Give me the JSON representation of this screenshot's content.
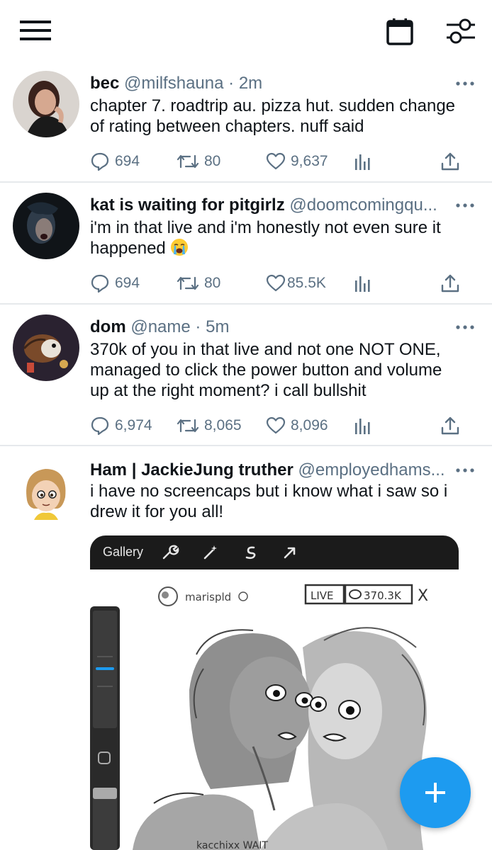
{
  "topbar": {
    "menu_icon": "hamburger-menu-icon",
    "calendar_icon": "calendar-icon",
    "filter_icon": "sliders-icon"
  },
  "tweets": [
    {
      "name": "bec",
      "handle": "@milfshauna",
      "sep": "·",
      "time": "2m",
      "text_lines": [
        "chapter 7. roadtrip au. pizza hut. sudden change",
        "of rating between chapters. nuff said"
      ],
      "replies": "694",
      "retweets": "80",
      "likes": "9,637"
    },
    {
      "name": "kat is waiting for pitgirlz",
      "handle": "@doomcomingqu...",
      "text_lines": [
        "i'm in that live and i'm honestly not even sure it",
        "happened"
      ],
      "emoji": "loudly-crying-face-emoji",
      "replies": "694",
      "retweets": "80",
      "likes": "85.5K"
    },
    {
      "name": "dom",
      "handle": "@name",
      "sep": "·",
      "time": "5m",
      "text_lines": [
        "370k of you in that live and not one  NOT ONE,",
        "managed to click the power button and volume",
        "up at the right moment? i call bullshit"
      ],
      "replies": "6,974",
      "retweets": "8,065",
      "likes": "8,096"
    },
    {
      "name": "Ham | JackieJung truther",
      "handle": "@employedhams...",
      "text_lines": [
        "i have no screencaps but i know what i saw so i",
        "drew it for you all!"
      ]
    }
  ],
  "media": {
    "app_label": "Gallery",
    "tools": [
      "wrench-icon",
      "magic-wand-icon",
      "smudge-icon",
      "arrow-icon"
    ],
    "drawing_texts": {
      "username": "marispld",
      "live_badge": "LIVE",
      "viewer_count": "370.3K",
      "close": "X",
      "caption": "kacchixx WAIT"
    }
  },
  "fab": {
    "icon": "plus-icon"
  },
  "colors": {
    "accent": "#1d9bf0",
    "text": "#0f1419",
    "secondary": "#5b7083",
    "divider": "#e6e9ec"
  }
}
